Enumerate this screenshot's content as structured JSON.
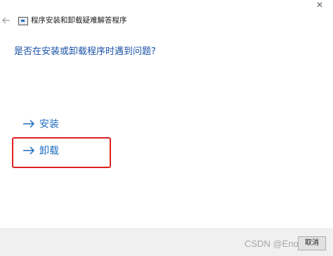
{
  "window": {
    "title": "程序安装和卸载疑难解答程序",
    "back_icon": "back-arrow-icon",
    "close_icon": "close-icon",
    "close_glyph": "✕"
  },
  "main": {
    "question": "是否在安装或卸载程序时遇到问题?",
    "options": [
      {
        "label": "安装",
        "icon": "right-arrow-icon"
      },
      {
        "label": "卸载",
        "icon": "right-arrow-icon",
        "highlighted": true
      }
    ]
  },
  "footer": {
    "watermark": "CSDN @Eno ... li",
    "cancel_label": "取消"
  },
  "colors": {
    "link": "#1f6fbf",
    "question": "#1a52a8",
    "highlight": "#e02020"
  }
}
